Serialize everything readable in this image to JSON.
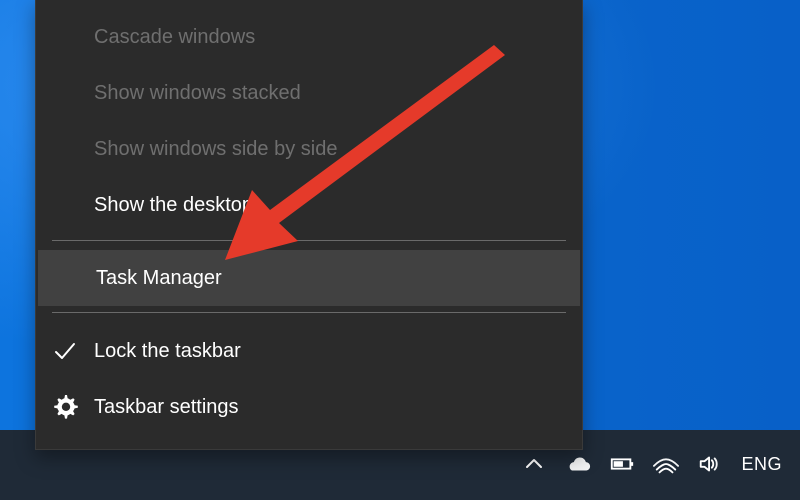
{
  "context_menu": {
    "items": [
      {
        "label": "Cascade windows",
        "enabled": false
      },
      {
        "label": "Show windows stacked",
        "enabled": false
      },
      {
        "label": "Show windows side by side",
        "enabled": false
      },
      {
        "label": "Show the desktop",
        "enabled": true
      },
      {
        "label": "Task Manager",
        "enabled": true,
        "highlighted": true
      },
      {
        "label": "Lock the taskbar",
        "enabled": true,
        "checked": true,
        "icon": "checkmark-icon"
      },
      {
        "label": "Taskbar settings",
        "enabled": true,
        "icon": "gear-icon"
      }
    ]
  },
  "taskbar": {
    "tray": {
      "icons": [
        "chevron-up-icon",
        "onedrive-cloud-icon",
        "battery-icon",
        "wifi-icon",
        "speaker-icon"
      ],
      "language": "ENG"
    }
  },
  "colors": {
    "menu_bg": "#2b2b2b",
    "menu_hover": "#414141",
    "disabled_text": "#6f6f6f",
    "text": "#ffffff",
    "arrow": "#e53a2a",
    "taskbar_bg": "#1f2a37",
    "desktop_blue": "#0b6bd5"
  }
}
